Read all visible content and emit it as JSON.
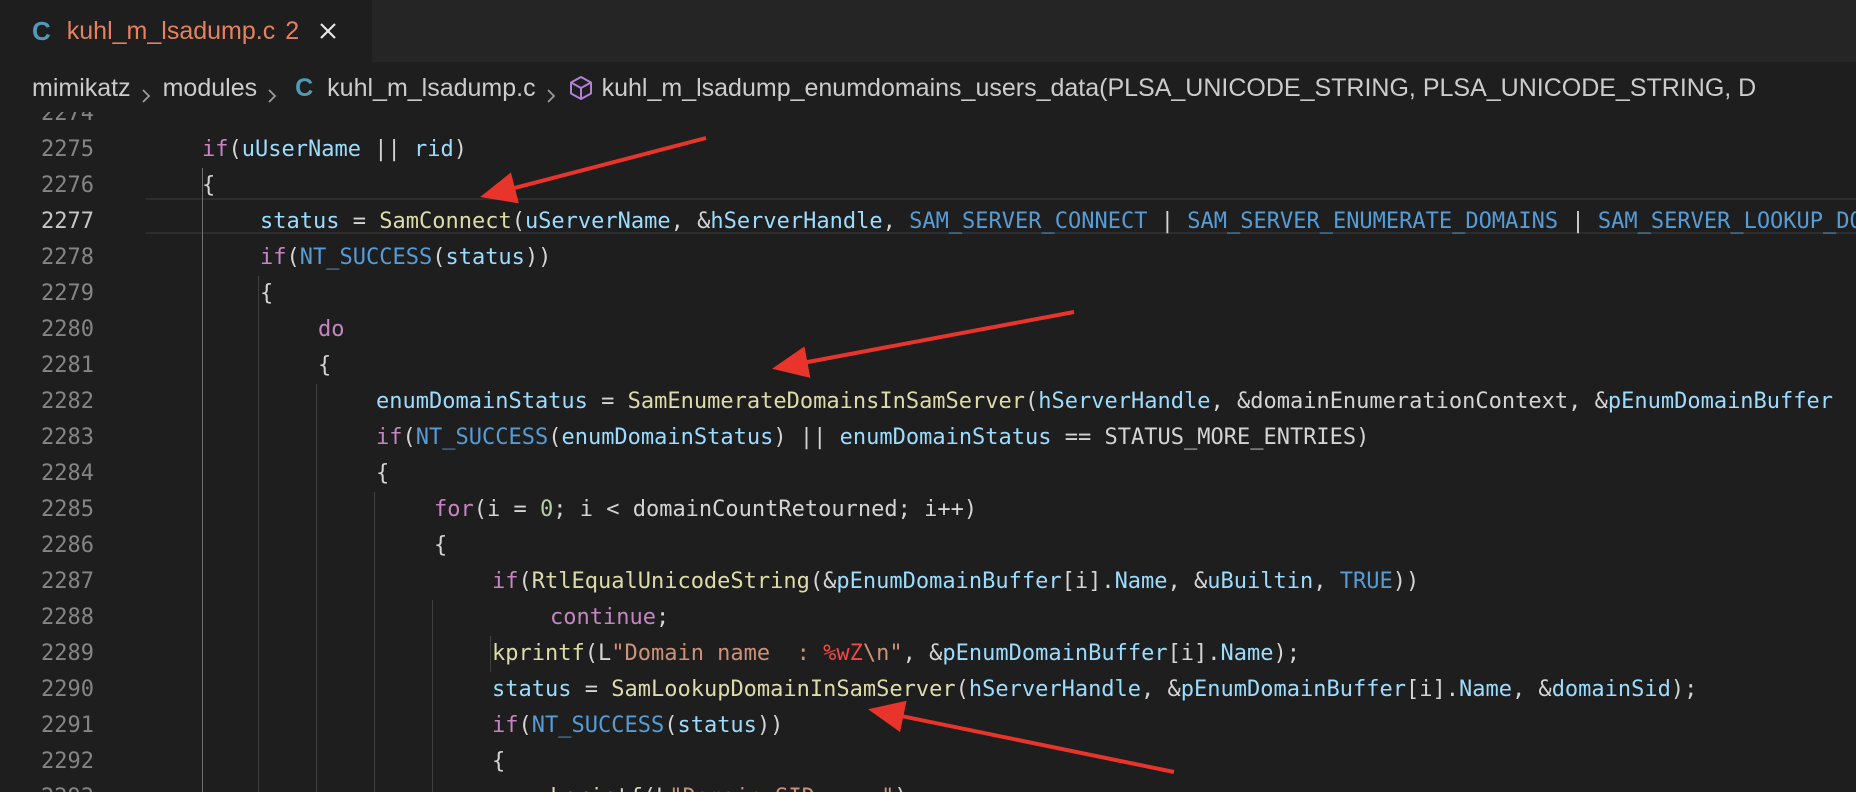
{
  "tab": {
    "language_icon": "C",
    "title": "kuhl_m_lsadump.c",
    "problem_count": "2",
    "close_icon": "close-icon"
  },
  "breadcrumb": {
    "items": [
      "mimikatz",
      "modules",
      "kuhl_m_lsadump.c",
      "kuhl_m_lsadump_enumdomains_users_data(PLSA_UNICODE_STRING, PLSA_UNICODE_STRING, D"
    ],
    "file_icon": "C",
    "symbol_icon": "method-cube-icon",
    "separator_icon": "chevron-right-icon"
  },
  "editor": {
    "current_line": "2277",
    "lines": [
      {
        "no": "2274",
        "tokens": []
      },
      {
        "no": "2275",
        "tokens": [
          [
            "k",
            "if"
          ],
          [
            "t",
            "("
          ],
          [
            "v",
            "uUserName"
          ],
          [
            "t",
            " || "
          ],
          [
            "v",
            "rid"
          ],
          [
            "t",
            ")"
          ]
        ]
      },
      {
        "no": "2276",
        "tokens": [
          [
            "t",
            "{"
          ]
        ]
      },
      {
        "no": "2277",
        "tokens": [
          [
            "v",
            "status"
          ],
          [
            "t",
            " = "
          ],
          [
            "f",
            "SamConnect"
          ],
          [
            "t",
            "("
          ],
          [
            "v",
            "uServerName"
          ],
          [
            "t",
            ", &"
          ],
          [
            "v",
            "hServerHandle"
          ],
          [
            "t",
            ", "
          ],
          [
            "m",
            "SAM_SERVER_CONNECT"
          ],
          [
            "t",
            " | "
          ],
          [
            "m",
            "SAM_SERVER_ENUMERATE_DOMAINS"
          ],
          [
            "t",
            " | "
          ],
          [
            "m",
            "SAM_SERVER_LOOKUP_DOMAIN"
          ]
        ]
      },
      {
        "no": "2278",
        "tokens": [
          [
            "k",
            "if"
          ],
          [
            "t",
            "("
          ],
          [
            "m",
            "NT_SUCCESS"
          ],
          [
            "t",
            "("
          ],
          [
            "v",
            "status"
          ],
          [
            "t",
            "))"
          ]
        ]
      },
      {
        "no": "2279",
        "tokens": [
          [
            "t",
            "{"
          ]
        ]
      },
      {
        "no": "2280",
        "tokens": [
          [
            "k",
            "do"
          ]
        ]
      },
      {
        "no": "2281",
        "tokens": [
          [
            "t",
            "{"
          ]
        ]
      },
      {
        "no": "2282",
        "tokens": [
          [
            "v",
            "enumDomainStatus"
          ],
          [
            "t",
            " = "
          ],
          [
            "f",
            "SamEnumerateDomainsInSamServer"
          ],
          [
            "t",
            "("
          ],
          [
            "v",
            "hServerHandle"
          ],
          [
            "t",
            ", &"
          ],
          [
            "t",
            "domainEnumerationContext"
          ],
          [
            "t",
            ", &"
          ],
          [
            "v",
            "pEnumDomainBuffer"
          ]
        ]
      },
      {
        "no": "2283",
        "tokens": [
          [
            "k",
            "if"
          ],
          [
            "t",
            "("
          ],
          [
            "m",
            "NT_SUCCESS"
          ],
          [
            "t",
            "("
          ],
          [
            "v",
            "enumDomainStatus"
          ],
          [
            "t",
            ") || "
          ],
          [
            "v",
            "enumDomainStatus"
          ],
          [
            "t",
            " == STATUS_MORE_ENTRIES)"
          ]
        ]
      },
      {
        "no": "2284",
        "tokens": [
          [
            "t",
            "{"
          ]
        ]
      },
      {
        "no": "2285",
        "tokens": [
          [
            "k",
            "for"
          ],
          [
            "t",
            "(i = "
          ],
          [
            "n",
            "0"
          ],
          [
            "t",
            "; i < domainCountRetourned; i++)"
          ]
        ]
      },
      {
        "no": "2286",
        "tokens": [
          [
            "t",
            "{"
          ]
        ]
      },
      {
        "no": "2287",
        "tokens": [
          [
            "k",
            "if"
          ],
          [
            "t",
            "("
          ],
          [
            "f",
            "RtlEqualUnicodeString"
          ],
          [
            "t",
            "(&"
          ],
          [
            "v",
            "pEnumDomainBuffer"
          ],
          [
            "t",
            "[i]."
          ],
          [
            "v",
            "Name"
          ],
          [
            "t",
            ", &"
          ],
          [
            "v",
            "uBuiltin"
          ],
          [
            "t",
            ", "
          ],
          [
            "m",
            "TRUE"
          ],
          [
            "t",
            "))"
          ]
        ]
      },
      {
        "no": "2288",
        "tokens": [
          [
            "k",
            "continue"
          ],
          [
            "t",
            ";"
          ]
        ]
      },
      {
        "no": "2289",
        "tokens": [
          [
            "f",
            "kprintf"
          ],
          [
            "t",
            "(L"
          ],
          [
            "s",
            "\"Domain name  : "
          ],
          [
            "e",
            "%wZ"
          ],
          [
            "s",
            "\\n\""
          ],
          [
            "t",
            ", &"
          ],
          [
            "v",
            "pEnumDomainBuffer"
          ],
          [
            "t",
            "[i]."
          ],
          [
            "v",
            "Name"
          ],
          [
            "t",
            ");"
          ]
        ]
      },
      {
        "no": "2290",
        "tokens": [
          [
            "v",
            "status"
          ],
          [
            "t",
            " = "
          ],
          [
            "f",
            "SamLookupDomainInSamServer"
          ],
          [
            "t",
            "("
          ],
          [
            "v",
            "hServerHandle"
          ],
          [
            "t",
            ", &"
          ],
          [
            "v",
            "pEnumDomainBuffer"
          ],
          [
            "t",
            "[i]."
          ],
          [
            "v",
            "Name"
          ],
          [
            "t",
            ", &"
          ],
          [
            "v",
            "domainSid"
          ],
          [
            "t",
            ");"
          ]
        ]
      },
      {
        "no": "2291",
        "tokens": [
          [
            "k",
            "if"
          ],
          [
            "t",
            "("
          ],
          [
            "m",
            "NT_SUCCESS"
          ],
          [
            "t",
            "("
          ],
          [
            "v",
            "status"
          ],
          [
            "t",
            "))"
          ]
        ]
      },
      {
        "no": "2292",
        "tokens": [
          [
            "t",
            "{"
          ]
        ]
      },
      {
        "no": "2293",
        "tokens": [
          [
            "f",
            "kprintf"
          ],
          [
            "t",
            "(L"
          ],
          [
            "s",
            "\"Domain SID   : \""
          ],
          [
            "t",
            ");"
          ]
        ]
      }
    ]
  },
  "annotation_color": "#e8342a"
}
